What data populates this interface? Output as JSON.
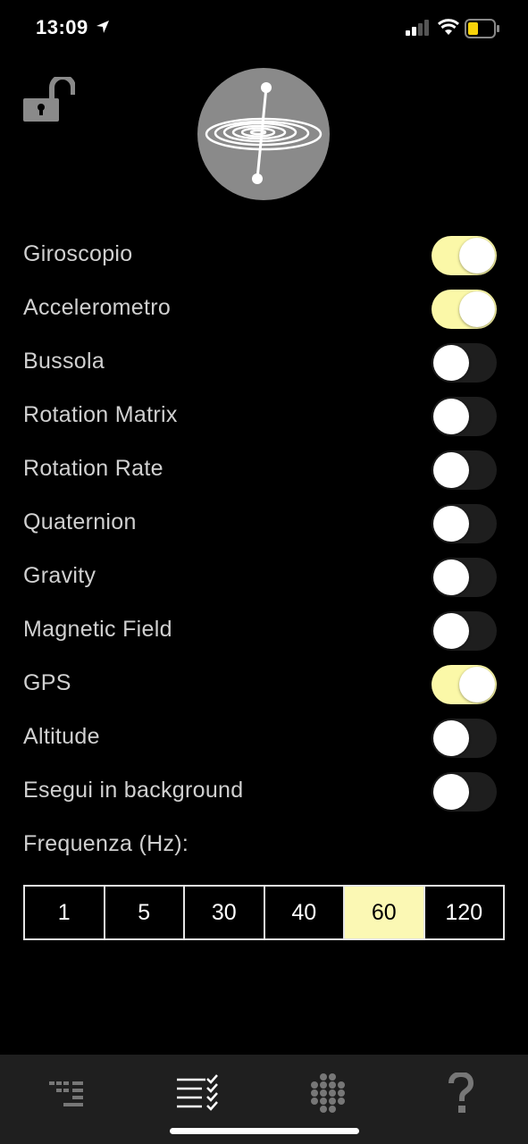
{
  "status_bar": {
    "time": "13:09",
    "icons": [
      "location-arrow-icon",
      "cellular-signal-icon",
      "wifi-icon",
      "battery-low-icon"
    ],
    "battery_color": "#f6d20a"
  },
  "header": {
    "lock_icon": "unlocked-padlock-icon",
    "logo_icon": "gyroscope-spiral-icon"
  },
  "settings": [
    {
      "label": "Giroscopio",
      "enabled": true
    },
    {
      "label": "Accelerometro",
      "enabled": true
    },
    {
      "label": "Bussola",
      "enabled": false
    },
    {
      "label": "Rotation Matrix",
      "enabled": false
    },
    {
      "label": "Rotation Rate",
      "enabled": false
    },
    {
      "label": "Quaternion",
      "enabled": false
    },
    {
      "label": "Gravity",
      "enabled": false
    },
    {
      "label": "Magnetic Field",
      "enabled": false
    },
    {
      "label": "GPS",
      "enabled": true
    },
    {
      "label": "Altitude",
      "enabled": false
    },
    {
      "label": "Esegui in background",
      "enabled": false
    }
  ],
  "frequency": {
    "label": "Frequenza (Hz):",
    "options": [
      "1",
      "5",
      "30",
      "40",
      "60",
      "120"
    ],
    "selected": "60"
  },
  "tab_bar": {
    "tabs": [
      {
        "icon": "data-lines-icon",
        "active": false
      },
      {
        "icon": "checklist-icon",
        "active": true
      },
      {
        "icon": "dot-grid-icon",
        "active": false
      },
      {
        "icon": "question-mark-icon",
        "active": false
      }
    ]
  },
  "colors": {
    "accent": "#fbf8a8",
    "toggle_off": "#1e1e1e",
    "tab_bar_bg": "#1f1f1f"
  }
}
